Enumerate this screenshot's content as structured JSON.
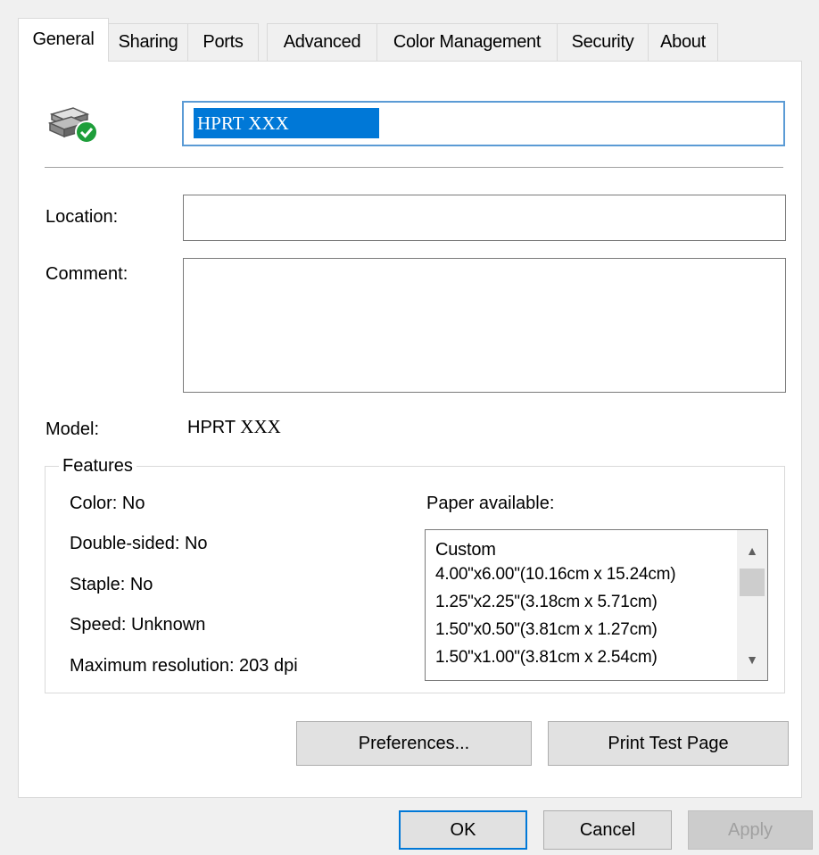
{
  "tabs": [
    {
      "label": "General",
      "active": true
    },
    {
      "label": "Sharing",
      "active": false
    },
    {
      "label": "Ports",
      "active": false
    },
    {
      "label": "Advanced",
      "active": false
    },
    {
      "label": "Color Management",
      "active": false
    },
    {
      "label": "Security",
      "active": false
    },
    {
      "label": "About",
      "active": false
    }
  ],
  "printer": {
    "icon": "printer-ready-icon",
    "name_value": "HPRT XXX"
  },
  "fields": {
    "location_label": "Location:",
    "location_value": "",
    "comment_label": "Comment:",
    "comment_value": ""
  },
  "model": {
    "label": "Model:",
    "value_part1": "HPRT",
    "value_part2": "XXX"
  },
  "features": {
    "title": "Features",
    "color": "Color: No",
    "double_sided": "Double-sided: No",
    "staple": "Staple: No",
    "speed": "Speed: Unknown",
    "max_resolution": "Maximum resolution: 203 dpi",
    "paper_label": "Paper available:",
    "paper_items": [
      "Custom",
      "4.00\"x6.00\"(10.16cm x 15.24cm)",
      "1.25\"x2.25\"(3.18cm x 5.71cm)",
      "1.50\"x0.50\"(3.81cm x 1.27cm)",
      "1.50\"x1.00\"(3.81cm x 2.54cm)"
    ]
  },
  "buttons": {
    "preferences": "Preferences...",
    "print_test_page": "Print Test Page",
    "ok": "OK",
    "cancel": "Cancel",
    "apply": "Apply"
  },
  "colors": {
    "selection": "#0078d7",
    "focus_border": "#5b9bd5",
    "status_ok": "#1e9e3a"
  }
}
